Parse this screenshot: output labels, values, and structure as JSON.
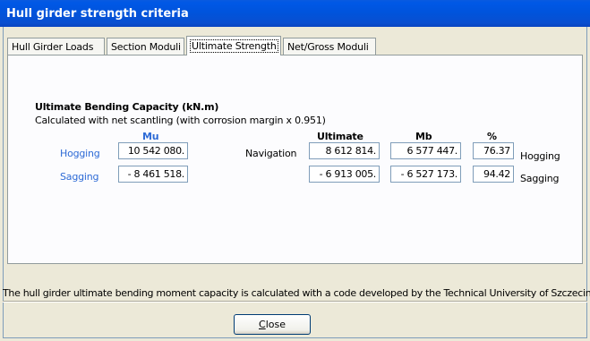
{
  "window": {
    "title": "Hull girder strength criteria"
  },
  "tabs": [
    {
      "label": "Hull Girder Loads"
    },
    {
      "label": "Section Moduli"
    },
    {
      "label": "Ultimate Strength"
    },
    {
      "label": "Net/Gross Moduli"
    }
  ],
  "active_tab": "Ultimate Strength",
  "panel": {
    "heading": "Ultimate Bending Capacity (kN.m)",
    "subheading": "Calculated with net scantling (with corrosion margin x 0.951)",
    "col_mu": "Mu",
    "col_ultimate": "Ultimate",
    "col_mb": "Mb",
    "col_pct": "%",
    "hogging_label": "Hogging",
    "sagging_label": "Sagging",
    "mu_hogging": "10 542 080.",
    "mu_sagging": "- 8 461 518.",
    "navigation_label": "Navigation",
    "ultimate_hogging": "8 612 814.",
    "ultimate_sagging": "- 6 913 005.",
    "mb_hogging": "6 577 447.",
    "mb_sagging": "- 6 527 173.",
    "pct_hogging": "76.37",
    "pct_sagging": "94.42",
    "row_hogging": "Hogging",
    "row_sagging": "Sagging"
  },
  "footer_note": "The hull girder ultimate bending moment capacity is calculated with a code developed by the Technical University of Szczecin",
  "buttons": {
    "close_prefix": "",
    "close_accel": "C",
    "close_rest": "lose"
  }
}
